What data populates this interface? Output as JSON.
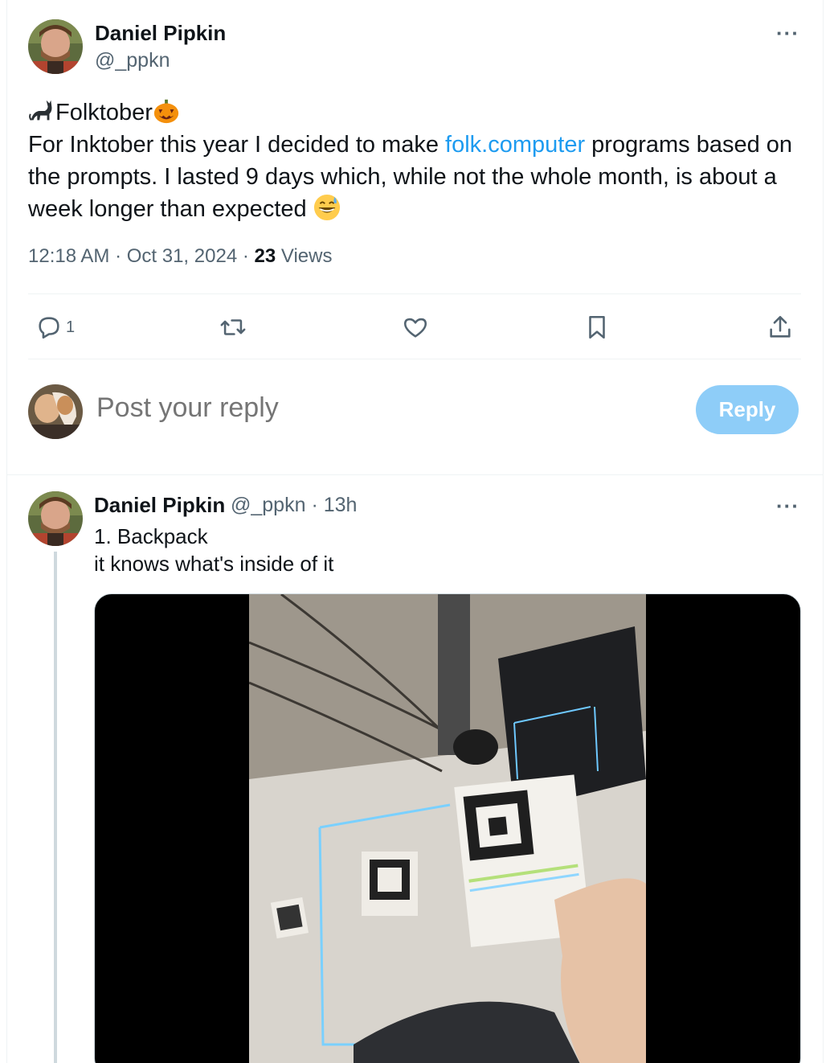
{
  "main_tweet": {
    "author_name": "Daniel Pipkin",
    "author_handle": "@_ppkn",
    "title_line": "Folktober",
    "body_before_link": "For Inktober this year I decided to make ",
    "link_text": "folk.computer",
    "body_after_link": " programs based on the prompts. I lasted 9 days which, while not the whole month, is about a week longer than expected",
    "time": "12:18 AM",
    "date": "Oct 31, 2024",
    "views_count": "23",
    "views_label": "Views",
    "more": "···",
    "emojis": [
      "black-cat",
      "jack-o-lantern",
      "grinning-sweat"
    ]
  },
  "actions": {
    "reply_count": "1",
    "icons": [
      "comment-icon",
      "retweet-icon",
      "like-icon",
      "bookmark-icon",
      "share-icon"
    ]
  },
  "compose": {
    "placeholder": "Post your reply",
    "button_label": "Reply"
  },
  "reply_tweet": {
    "author_name": "Daniel Pipkin",
    "author_handle": "@_ppkn",
    "separator": "·",
    "age": "13h",
    "more": "···",
    "line1": "1. Backpack",
    "line2": "it knows what's inside of it"
  },
  "colors": {
    "accent": "#1d9bf0",
    "reply_button": "#8ecdf8",
    "secondary_text": "#536471",
    "divider": "#eff3f4"
  }
}
